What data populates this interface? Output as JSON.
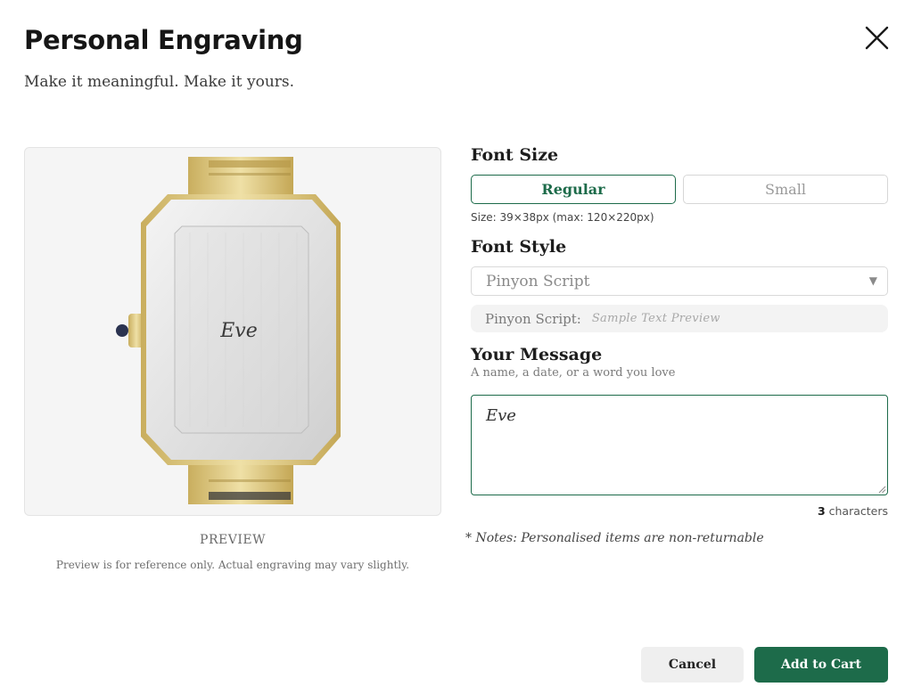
{
  "header": {
    "title": "Personal Engraving",
    "subtitle": "Make it meaningful. Make it yours."
  },
  "preview": {
    "engraving_text": "Eve",
    "label": "PREVIEW",
    "note": "Preview is for reference only. Actual engraving may vary slightly."
  },
  "font_size": {
    "heading": "Font Size",
    "options": [
      "Regular",
      "Small"
    ],
    "selected": "Regular",
    "info": "Size: 39×38px (max: 120×220px)"
  },
  "font_style": {
    "heading": "Font Style",
    "selected": "Pinyon Script",
    "preview_label": "Pinyon Script:",
    "preview_sample": "Sample Text Preview"
  },
  "message": {
    "heading": "Your Message",
    "hint": "A name, a date, or a word you love",
    "value": "Eve",
    "char_count": "3",
    "char_count_suffix": " characters"
  },
  "note": "* Notes: Personalised items are non-returnable",
  "actions": {
    "cancel": "Cancel",
    "add_to_cart": "Add to Cart"
  },
  "colors": {
    "accent": "#1d6b4a",
    "gold": "#d8c27a",
    "steel": "#e2e2e2"
  }
}
